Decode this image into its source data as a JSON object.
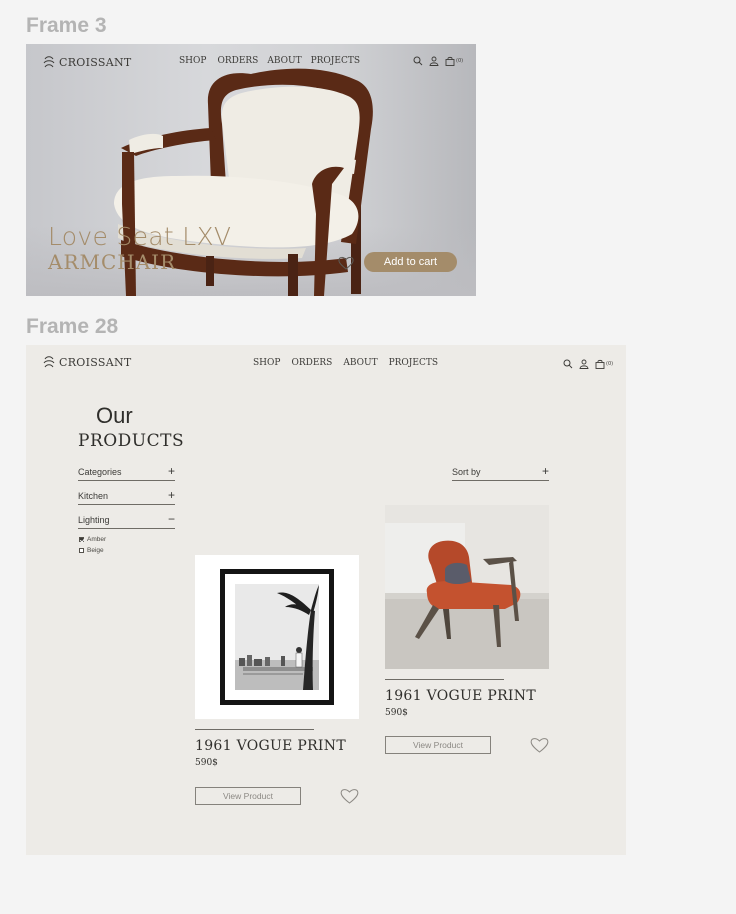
{
  "frame3": {
    "label": "Frame 3",
    "logo_text": "CROISSANT",
    "nav": [
      "SHOP",
      "ORDERS",
      "ABOUT",
      "PROJECTS"
    ],
    "cart_count": "(0)",
    "hero_title": "Love Seat LXV",
    "hero_subtitle": "ARMCHAIR",
    "add_to_cart": "Add to cart"
  },
  "frame28": {
    "label": "Frame 28",
    "logo_text": "CROISSANT",
    "nav": [
      "SHOP",
      "ORDERS",
      "ABOUT",
      "PROJECTS"
    ],
    "cart_count": "(0)",
    "title_line1": "Our",
    "title_line2": "PRODUCTS",
    "filters": [
      {
        "label": "Categories",
        "symbol": "+"
      },
      {
        "label": "Kitchen",
        "symbol": "+"
      },
      {
        "label": "Lighting",
        "symbol": "−"
      }
    ],
    "options": [
      {
        "label": "Amber",
        "checked": true
      },
      {
        "label": "Beige",
        "checked": false
      }
    ],
    "sort_label": "Sort by",
    "sort_symbol": "+",
    "products": [
      {
        "name": "1961 VOGUE PRINT",
        "price": "590$",
        "button": "View Product"
      },
      {
        "name": "1961 VOGUE PRINT",
        "price": "590$",
        "button": "View Product"
      }
    ]
  },
  "colors": {
    "accent": "#a48c6a",
    "frame_bg": "#edebe7",
    "text_dark": "#2f2e2b"
  }
}
